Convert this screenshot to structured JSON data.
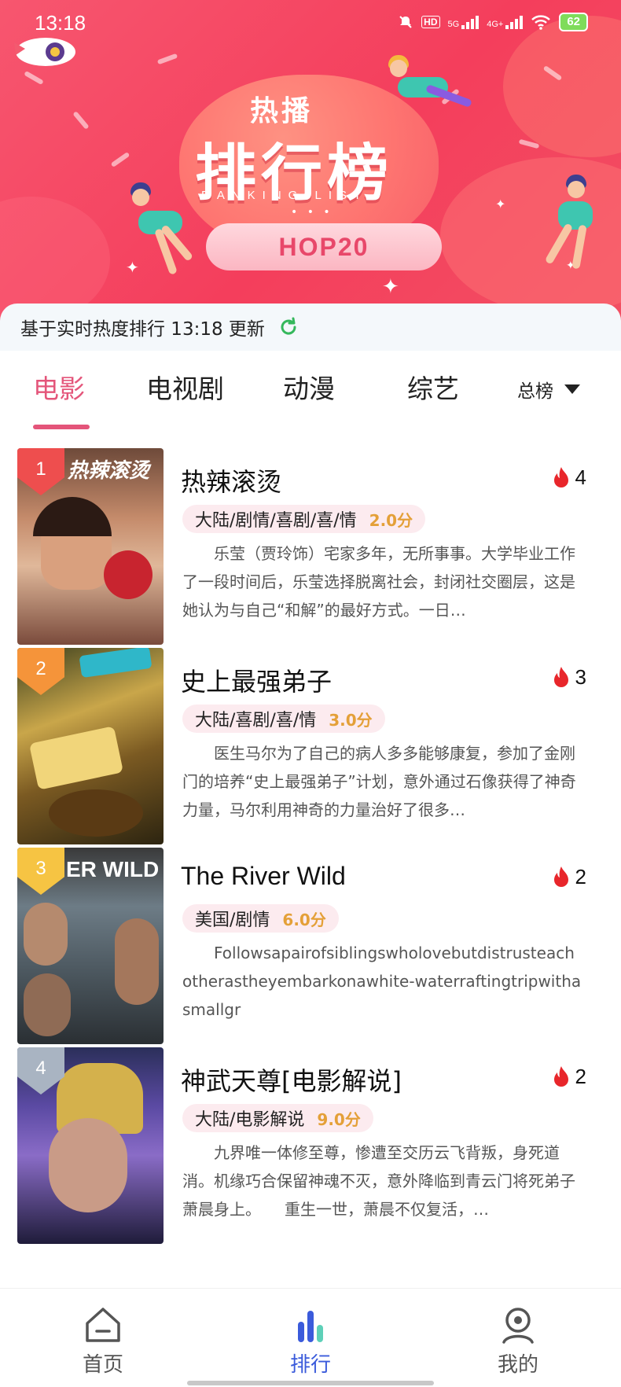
{
  "status_bar": {
    "time": "13:18",
    "network_hd": "HD",
    "network_5g": "5G",
    "network_4g": "4G+",
    "battery": "62"
  },
  "banner": {
    "sub_title": "热播",
    "main_title": "排行榜",
    "en_title": "RANKING LIST",
    "dots": "• • •",
    "ribbon": "HOP20"
  },
  "update_bar": {
    "text": "基于实时热度排行 13:18 更新"
  },
  "tabs": [
    {
      "label": "电影"
    },
    {
      "label": "电视剧"
    },
    {
      "label": "动漫"
    },
    {
      "label": "综艺"
    }
  ],
  "filter": {
    "label": "总榜"
  },
  "items": [
    {
      "rank": "1",
      "title": "热辣滚烫",
      "heat": "4",
      "genre": "大陆/剧情/喜剧/喜/情",
      "score": "2.0分",
      "synopsis": "乐莹（贾玲饰）宅家多年，无所事事。大学毕业工作了一段时间后，乐莹选择脱离社会，封闭社交圈层，这是她认为与自己“和解”的最好方式。一日…",
      "poster_text": "热辣滚烫"
    },
    {
      "rank": "2",
      "title": "史上最强弟子",
      "heat": "3",
      "genre": "大陆/喜剧/喜/情",
      "score": "3.0分",
      "synopsis": "医生马尔为了自己的病人多多能够康复，参加了金刚门的培养“史上最强弟子”计划，意外通过石像获得了神奇力量，马尔利用神奇的力量治好了很多…",
      "poster_text": ""
    },
    {
      "rank": "3",
      "title": "The River Wild",
      "heat": "2",
      "genre": "美国/剧情",
      "score": "6.0分",
      "synopsis": "Followsapairofsiblingswholovebutdistrusteachotherastheyembarkonawhite-waterraftingtripwithasmallgr",
      "poster_text": "ER WILD"
    },
    {
      "rank": "4",
      "title": "神武天尊[电影解说]",
      "heat": "2",
      "genre": "大陆/电影解说",
      "score": "9.0分",
      "synopsis": "九界唯一体修至尊，惨遭至交历云飞背叛，身死道消。机缘巧合保留神魂不灭，意外降临到青云门将死弟子萧晨身上。　　重生一世，萧晨不仅复活，…",
      "poster_text": ""
    }
  ],
  "bottom_nav": [
    {
      "label": "首页",
      "icon": "home-icon"
    },
    {
      "label": "排行",
      "icon": "ranking-icon"
    },
    {
      "label": "我的",
      "icon": "profile-icon"
    }
  ],
  "colors": {
    "accent": "#e4557a",
    "banner": "#f43e5c",
    "score": "#e4a038",
    "rank1": "#ee4e4e",
    "rank2": "#f5943a",
    "rank3": "#f6c443",
    "rank4": "#a9b4c2",
    "nav_active": "#3b5bdb"
  }
}
